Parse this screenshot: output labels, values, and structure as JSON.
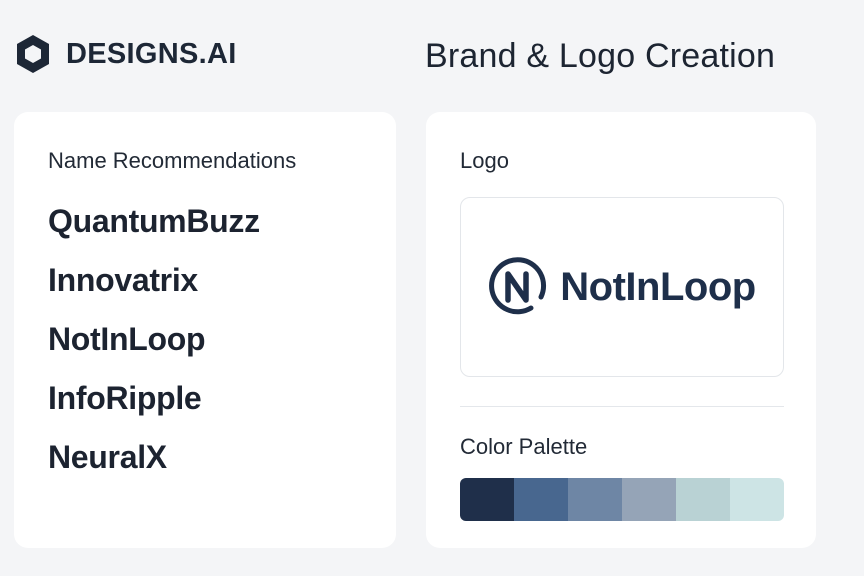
{
  "brand": {
    "name": "DESIGNS.AI",
    "logo_icon": "hexagon-icon"
  },
  "page_title": "Brand & Logo Creation",
  "names_panel": {
    "title": "Name Recommendations",
    "names": [
      "QuantumBuzz",
      "Innovatrix",
      "NotInLoop",
      "InfoRipple",
      "NeuralX"
    ]
  },
  "logo_panel": {
    "title": "Logo",
    "logo_icon": "n-loop-icon",
    "logo_text": "NotInLoop"
  },
  "palette_panel": {
    "title": "Color Palette",
    "colors": [
      "#1f2f4a",
      "#48678f",
      "#6e86a5",
      "#95a4b7",
      "#b9d2d4",
      "#cde4e5"
    ]
  }
}
